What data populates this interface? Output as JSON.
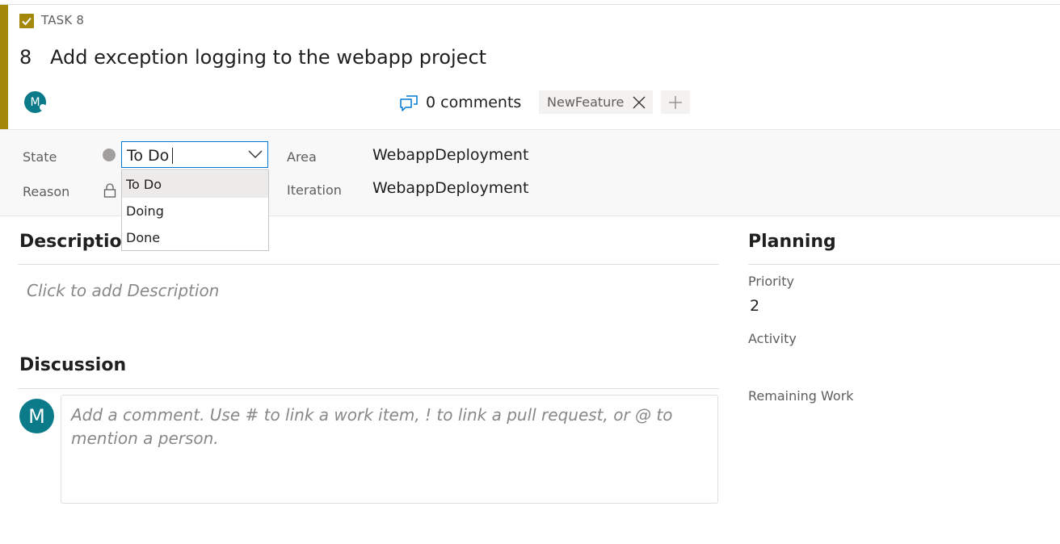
{
  "colors": {
    "accent": "#a4880a",
    "avatar": "#0b7a89",
    "focus": "#0078d4"
  },
  "header": {
    "type_label": "TASK 8",
    "id": "8",
    "title": "Add exception logging to the webapp project",
    "avatar_initial": "M",
    "comments_count_label": "0 comments",
    "tags": [
      {
        "label": "NewFeature"
      }
    ]
  },
  "fields": {
    "state": {
      "label": "State",
      "value": "To Do"
    },
    "reason": {
      "label": "Reason"
    },
    "area": {
      "label": "Area",
      "value": "WebappDeployment"
    },
    "iteration": {
      "label": "Iteration",
      "value": "WebappDeployment"
    }
  },
  "state_dropdown": {
    "options": [
      "To Do",
      "Doing",
      "Done"
    ],
    "selected_index": 0
  },
  "description": {
    "title": "Description",
    "placeholder": "Click to add Description"
  },
  "discussion": {
    "title": "Discussion",
    "avatar_initial": "M",
    "placeholder": "Add a comment. Use # to link a work item, ! to link a pull request, or @ to mention a person."
  },
  "planning": {
    "title": "Planning",
    "priority": {
      "label": "Priority",
      "value": "2"
    },
    "activity": {
      "label": "Activity"
    },
    "remaining_work": {
      "label": "Remaining Work"
    }
  }
}
